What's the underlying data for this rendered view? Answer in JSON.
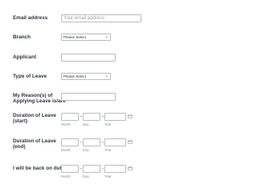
{
  "form": {
    "email": {
      "label": "Email address",
      "placeholder": "Your email address"
    },
    "branch": {
      "label": "Branch",
      "selected": "Please Select"
    },
    "applicant": {
      "label": "Applicant",
      "value": ""
    },
    "leave_type": {
      "label": "Type of Leave",
      "selected": "Please Select"
    },
    "reason": {
      "label": "My Reason(s) of Applying Leave is/are",
      "value": ""
    },
    "duration_start": {
      "label": "Duration of Leave (start)",
      "separator": "-",
      "sublabels": {
        "month": "Month",
        "day": "Day",
        "year": "Year"
      }
    },
    "duration_end": {
      "label": "Duration of Leave (end)",
      "separator": "-",
      "sublabels": {
        "month": "Month",
        "day": "Day",
        "year": "Year"
      }
    },
    "back_on_duty": {
      "label": "I will be back on duty",
      "separator": "-",
      "sublabels": {
        "month": "Month",
        "day": "Day",
        "year": "Year"
      }
    }
  },
  "icons": {
    "dropdown": "chevron-down-icon",
    "calendar": "calendar-icon"
  },
  "colors": {
    "text": "#2c3345",
    "border": "#b9bcc4",
    "sublabel": "#8a8e98",
    "placeholder": "#9a9ea8"
  }
}
